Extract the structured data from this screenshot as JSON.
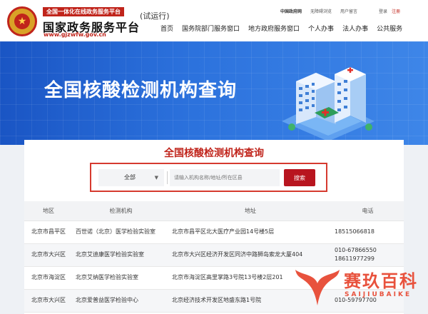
{
  "header": {
    "banner_tag": "全国一体化在线政务服务平台",
    "title": "国家政务服务平台",
    "url": "www.gjzwfw.gov.cn",
    "trial": "(试运行)",
    "top_links": [
      "中国政府网",
      "无障碍浏览",
      "用户留言",
      "登录",
      "注册"
    ],
    "nav": [
      "首页",
      "国务院部门服务窗口",
      "地方政府服务窗口",
      "个人办事",
      "法人办事",
      "公共服务"
    ]
  },
  "hero": {
    "title": "全国核酸检测机构查询"
  },
  "panel": {
    "title": "全国核酸检测机构查询",
    "select_value": "全部",
    "search_placeholder": "请输入机构名称/地址/所在区县",
    "search_button": "搜索"
  },
  "table": {
    "headers": [
      "地区",
      "检测机构",
      "地址",
      "电话"
    ],
    "rows": [
      {
        "region": "北京市昌平区",
        "org": "百世诺（北京）医学检验实验室",
        "addr": "北京市昌平区北大医疗产业园14号楼5层",
        "phone": "18515066818"
      },
      {
        "region": "北京市大兴区",
        "org": "北京艾迪康医学检验实验室",
        "addr": "北京市大兴区经济开发区同济中路狮岛索龙大厦404",
        "phone": "010-67866550 18611977299"
      },
      {
        "region": "北京市海淀区",
        "org": "北京艾纳医学检验实验室",
        "addr": "北京市海淀区高里掌路3号院13号楼2层201",
        "phone": ""
      },
      {
        "region": "北京市大兴区",
        "org": "北京爱普益医学检验中心",
        "addr": "北京经济技术开发区地盛东路1号院",
        "phone": "010-59797700"
      }
    ]
  },
  "watermark": {
    "text": "赛玖百科",
    "sub": "SAIJIUBAIKE"
  },
  "colors": {
    "brand_red": "#c0241b",
    "hero_blue": "#2c72dd",
    "search_btn": "#b8151f"
  }
}
